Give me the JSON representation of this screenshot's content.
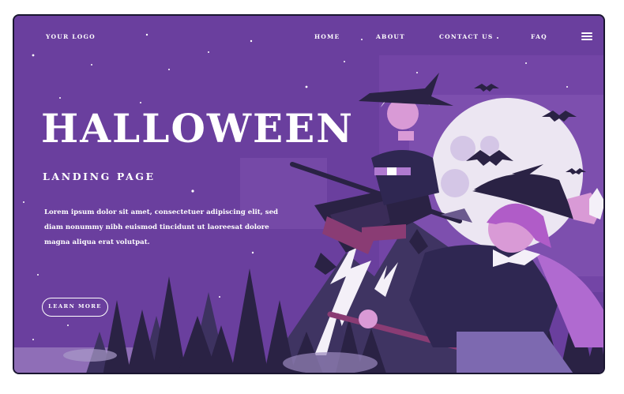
{
  "nav": {
    "logo": "YOUR LOGO",
    "links": [
      "HOME",
      "ABOUT",
      "CONTACT US",
      "FAQ"
    ],
    "menu_icon": "hamburger-menu-icon"
  },
  "hero": {
    "title": "HALLOWEEN",
    "subtitle": "LANDING PAGE",
    "body": "Lorem ipsum dolor sit amet, consectetuer adipiscing elit, sed diam nonummy nibh euismod tincidunt ut laoreesat dolore magna aliqua erat volutpat.",
    "cta_label": "LEARN MORE"
  },
  "colors": {
    "background": "#6a3f9e",
    "moon": "#ece6f2",
    "trees": "#2a2244",
    "text": "#ffffff"
  }
}
